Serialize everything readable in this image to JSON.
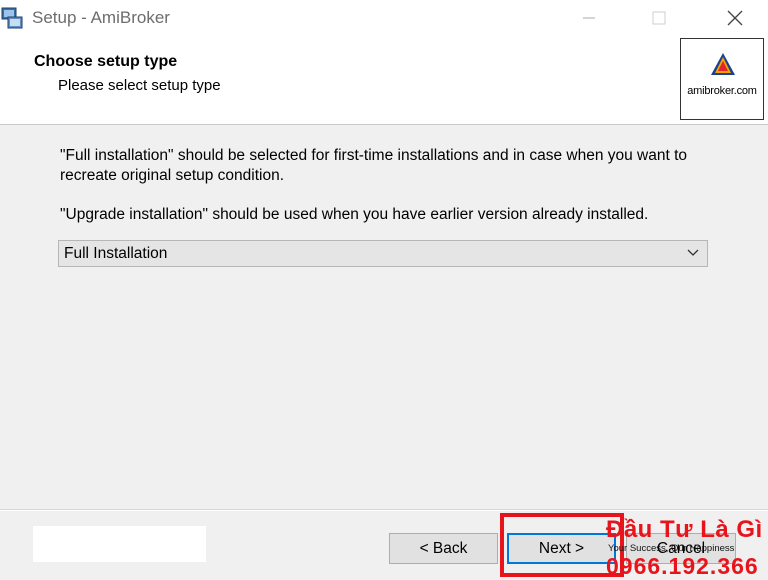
{
  "window": {
    "title": "Setup - AmiBroker",
    "icon": "setup-installer-icon"
  },
  "header": {
    "title": "Choose setup type",
    "subtitle": "Please select setup type",
    "logo_text": "amibroker.com"
  },
  "content": {
    "paragraph1": "\"Full installation\" should be selected for first-time installations and in case when you want to recreate original setup condition.",
    "paragraph2": "\"Upgrade installation\" should be used when you have earlier version already installed.",
    "setup_type_select": {
      "selected": "Full Installation"
    }
  },
  "footer": {
    "back_label": "< Back",
    "next_label": "Next >",
    "cancel_label": "Cancel"
  },
  "watermark": {
    "brand": "Đầu Tư Là Gì",
    "slogan": "Your Success, Our Happiness",
    "phone": "0966.192.366"
  },
  "colors": {
    "accent": "#0078d7",
    "highlight": "#e8141b"
  }
}
